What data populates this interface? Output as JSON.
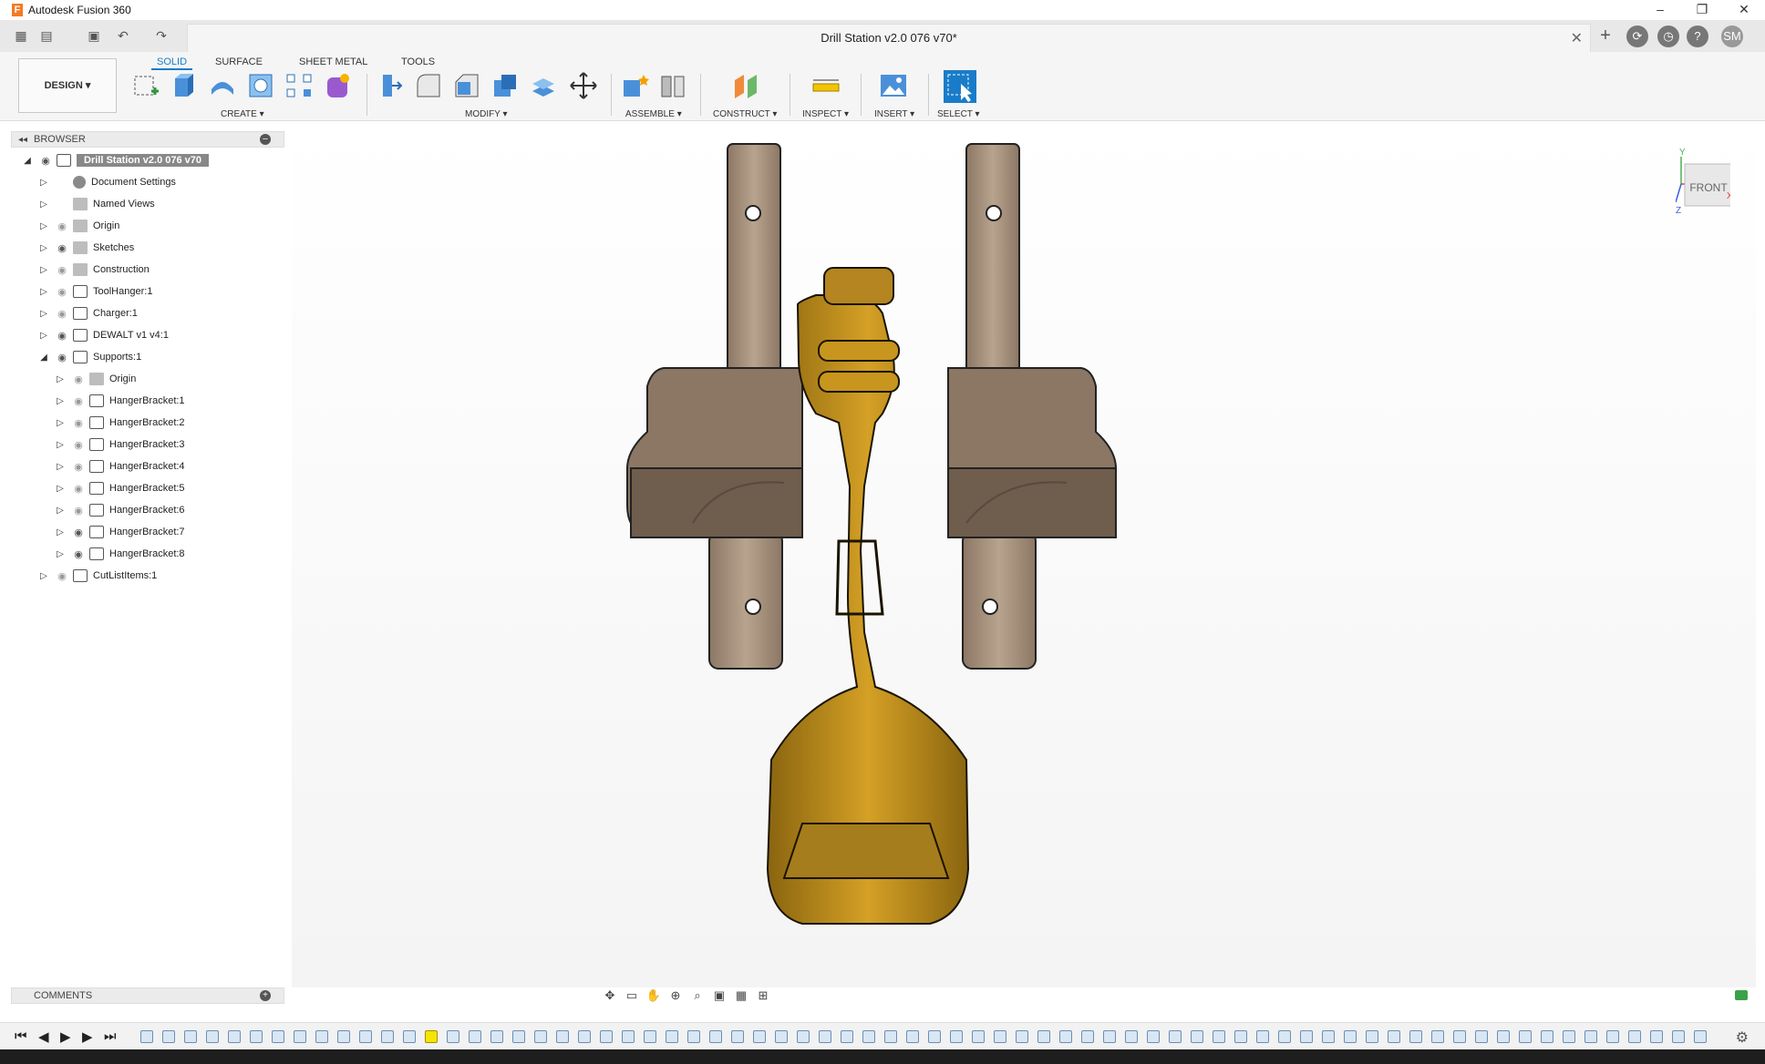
{
  "app": {
    "title": "Autodesk Fusion 360",
    "logo_letter": "F"
  },
  "window_controls": [
    "–",
    "❐",
    "✕"
  ],
  "document": {
    "title": "Drill Station v2.0 076 v70*",
    "close": "✕"
  },
  "user": {
    "initials": "SM"
  },
  "toolbar": {
    "workspace": "DESIGN ▾",
    "tabs": [
      "SOLID",
      "SURFACE",
      "SHEET METAL",
      "TOOLS"
    ],
    "active_tab": "SOLID",
    "groups": [
      "CREATE ▾",
      "MODIFY ▾",
      "ASSEMBLE ▾",
      "CONSTRUCT ▾",
      "INSPECT ▾",
      "INSERT ▾",
      "SELECT ▾"
    ]
  },
  "browser": {
    "title": "BROWSER",
    "root": "Drill Station v2.0 076 v70",
    "items": [
      {
        "label": "Document Settings",
        "icon": "gear-icon"
      },
      {
        "label": "Named Views",
        "icon": "folder-icon"
      },
      {
        "label": "Origin",
        "icon": "folder-icon"
      },
      {
        "label": "Sketches",
        "icon": "folder-icon"
      },
      {
        "label": "Construction",
        "icon": "folder-icon"
      },
      {
        "label": "ToolHanger:1",
        "icon": "component-icon"
      },
      {
        "label": "Charger:1",
        "icon": "component-icon"
      },
      {
        "label": "DEWALT v1 v4:1",
        "icon": "link-icon"
      },
      {
        "label": "Supports:1",
        "icon": "component-icon"
      },
      {
        "label": "Origin",
        "icon": "folder-icon"
      },
      {
        "label": "HangerBracket:1",
        "icon": "component-icon"
      },
      {
        "label": "HangerBracket:2",
        "icon": "component-icon"
      },
      {
        "label": "HangerBracket:3",
        "icon": "component-icon"
      },
      {
        "label": "HangerBracket:4",
        "icon": "component-icon"
      },
      {
        "label": "HangerBracket:5",
        "icon": "component-icon"
      },
      {
        "label": "HangerBracket:6",
        "icon": "component-icon"
      },
      {
        "label": "HangerBracket:7",
        "icon": "component-icon"
      },
      {
        "label": "HangerBracket:8",
        "icon": "component-icon"
      },
      {
        "label": "CutListItems:1",
        "icon": "component-icon"
      }
    ]
  },
  "viewcube": {
    "face": "FRONT",
    "x": "X",
    "y": "Y",
    "z": "Z"
  },
  "comments": {
    "title": "COMMENTS"
  },
  "colors": {
    "accent": "#1a7cc9",
    "wood": "#8b7764",
    "drill": "#c8961e"
  }
}
